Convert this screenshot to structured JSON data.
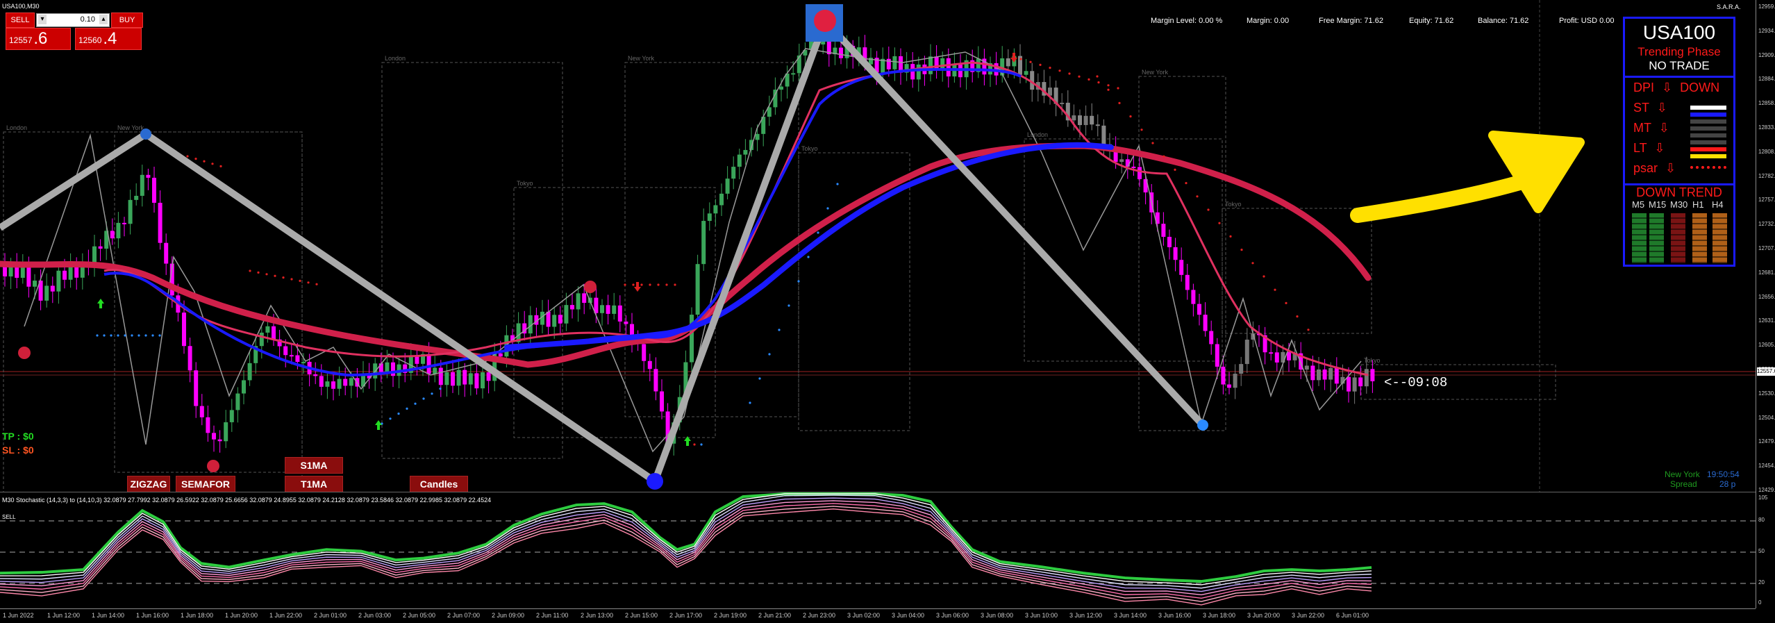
{
  "window": {
    "symbol_title": "USA100,M30",
    "indicator_name": "S.A.R.A."
  },
  "account_bar": {
    "margin_level": "Margin Level: 0.00 %",
    "margin": "Margin: 0.00",
    "free_margin": "Free Margin: 71.62",
    "equity": "Equity: 71.62",
    "balance": "Balance: 71.62",
    "profit": "Profit: USD 0.00"
  },
  "trade_panel": {
    "sell_label": "SELL",
    "buy_label": "BUY",
    "lot_value": "0.10",
    "sell_price_small": "12557",
    "sell_price_big": ".6",
    "buy_price_small": "12560",
    "buy_price_big": ".4"
  },
  "sara_panel": {
    "symbol": "USA100",
    "phase": "Trending Phase",
    "signal": "NO TRADE",
    "rows": [
      {
        "label": "DPI",
        "arrow": "⇩",
        "extra": "DOWN"
      },
      {
        "label": "ST",
        "arrow": "⇩",
        "extra": ""
      },
      {
        "label": "MT",
        "arrow": "⇩",
        "extra": ""
      },
      {
        "label": "LT",
        "arrow": "⇩",
        "extra": ""
      },
      {
        "label": "psar",
        "arrow": "⇩",
        "extra": ""
      }
    ],
    "down_trend_title": "DOWN TREND",
    "timeframes": [
      "M5",
      "M15",
      "M30",
      "H1",
      "H4"
    ],
    "colors": {
      "border": "#1a1aff",
      "text": "#ff1a1a"
    }
  },
  "chart_buttons": {
    "zigzag": "ZIGZAG",
    "semafor": "SEMAFOR",
    "s1ma": "S1MA",
    "t1ma": "T1MA",
    "candles": "Candles"
  },
  "tp_label": "TP : $0",
  "sl_label": "SL : $0",
  "countdown": "<--09:08",
  "session_info": {
    "session": "New York",
    "time": "19:50:54",
    "spread_label": "Spread",
    "spread_value": "28 p"
  },
  "current_price_label": "12557.6",
  "price_axis": [
    "12959.75",
    "12934.55",
    "12909.35",
    "12884.15",
    "12858.95",
    "12833.75",
    "12808.55",
    "12782.85",
    "12757.65",
    "12732.45",
    "12707.25",
    "12681.55",
    "12656.35",
    "12631.15",
    "12605.95",
    "12580.75",
    "12530.35",
    "12504.65",
    "12479.45",
    "12454.25",
    "12429.05"
  ],
  "stoch": {
    "title": "M30 Stochastic (14,3,3) to (14,10,3) 32.0879 27.7992 32.0879 26.5922 32.0879 25.6656 32.0879 24.8955 32.0879 24.2128 32.0879 23.5846 32.0879 22.9985 32.0879 22.4524",
    "sell_label": "SELL",
    "levels": [
      "105",
      "80",
      "50",
      "20",
      "0"
    ]
  },
  "session_boxes": [
    "London",
    "New York",
    "London",
    "Tokyo",
    "New York",
    "Tokyo",
    "London",
    "New York",
    "Tokyo",
    "Tokyo"
  ],
  "time_axis": [
    "1 Jun 2022",
    "1 Jun 12:00",
    "1 Jun 14:00",
    "1 Jun 16:00",
    "1 Jun 18:00",
    "1 Jun 20:00",
    "1 Jun 22:00",
    "2 Jun 01:00",
    "2 Jun 03:00",
    "2 Jun 05:00",
    "2 Jun 07:00",
    "2 Jun 09:00",
    "2 Jun 11:00",
    "2 Jun 13:00",
    "2 Jun 15:00",
    "2 Jun 17:00",
    "2 Jun 19:00",
    "2 Jun 21:00",
    "2 Jun 23:00",
    "3 Jun 02:00",
    "3 Jun 04:00",
    "3 Jun 06:00",
    "3 Jun 08:00",
    "3 Jun 10:00",
    "3 Jun 12:00",
    "3 Jun 14:00",
    "3 Jun 16:00",
    "3 Jun 18:00",
    "3 Jun 20:00",
    "3 Jun 22:00",
    "6 Jun 01:00"
  ]
}
